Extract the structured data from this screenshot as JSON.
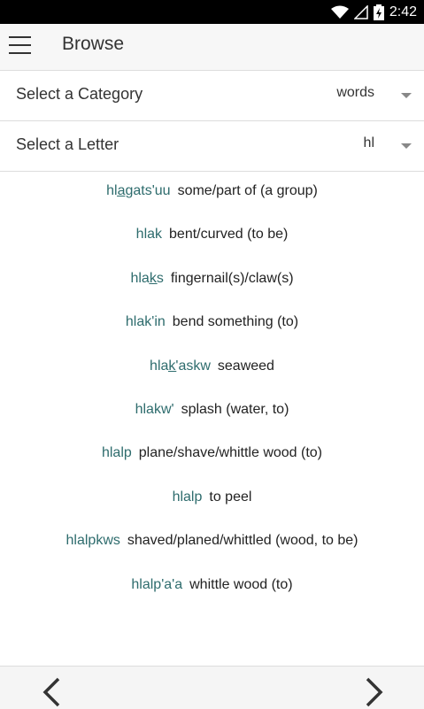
{
  "status_bar": {
    "time": "2:42",
    "icons": [
      "wifi-icon",
      "signal-icon",
      "battery-charging-icon"
    ]
  },
  "header": {
    "title": "Browse"
  },
  "category_select": {
    "label": "Select a Category",
    "value": "words"
  },
  "letter_select": {
    "label": "Select a Letter",
    "value": "hl"
  },
  "entries": [
    {
      "word": "hla̲gats'uu",
      "definition": "some/part of (a group)"
    },
    {
      "word": "hlak",
      "definition": "bent/curved (to be)"
    },
    {
      "word": "hlak̲s",
      "definition": "fingernail(s)/claw(s)"
    },
    {
      "word": "hlak'in",
      "definition": "bend something (to)"
    },
    {
      "word": "hlak̲'askw",
      "definition": "seaweed"
    },
    {
      "word": "hlakw'",
      "definition": "splash (water, to)"
    },
    {
      "word": "hlalp",
      "definition": "plane/shave/whittle wood (to)"
    },
    {
      "word": "hlalp",
      "definition": "to peel"
    },
    {
      "word": "hlalpkws",
      "definition": "shaved/planed/whittled (wood, to be)"
    },
    {
      "word": "hlalp'a'a",
      "definition": "whittle wood (to)"
    }
  ],
  "colors": {
    "word": "#2e6c6d",
    "statusbar": "#000000",
    "appbar": "#f7f7f7"
  }
}
